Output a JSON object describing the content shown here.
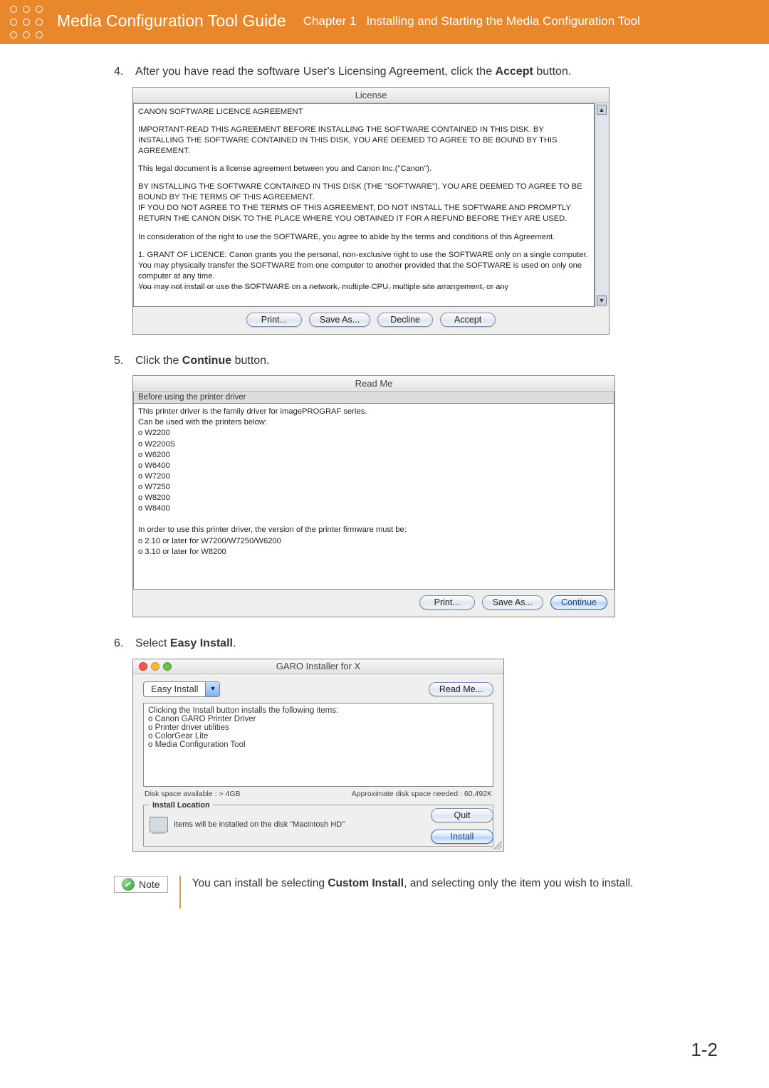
{
  "header": {
    "guide_title": "Media Configuration Tool Guide",
    "chapter_label": "Chapter 1",
    "chapter_title": "Installing and Starting the Media Configuration Tool"
  },
  "steps": {
    "s4": {
      "num": "4.",
      "text_before": "After you have read the software User's Licensing Agreement, click the ",
      "bold": "Accept",
      "text_after": " button."
    },
    "s5": {
      "num": "5.",
      "text_before": "Click the ",
      "bold": "Continue",
      "text_after": " button."
    },
    "s6": {
      "num": "6.",
      "text_before": "Select ",
      "bold": "Easy Install",
      "text_after": "."
    }
  },
  "license_dialog": {
    "title": "License",
    "p1": "CANON SOFTWARE LICENCE AGREEMENT",
    "p2": "IMPORTANT-READ THIS AGREEMENT BEFORE INSTALLING THE SOFTWARE CONTAINED IN THIS DISK. BY INSTALLING THE SOFTWARE CONTAINED IN THIS DISK, YOU ARE DEEMED TO AGREE TO BE BOUND BY THIS AGREEMENT.",
    "p3": "This legal document is a license agreement between you and Canon Inc.(\"Canon\").",
    "p4": "BY INSTALLING THE SOFTWARE CONTAINED IN THIS DISK (THE \"SOFTWARE\"), YOU ARE DEEMED TO AGREE TO BE BOUND BY THE TERMS OF THIS AGREEMENT.",
    "p5": "IF YOU DO NOT AGREE TO THE TERMS OF THIS AGREEMENT, DO NOT INSTALL THE SOFTWARE AND PROMPTLY RETURN THE CANON DISK TO THE PLACE WHERE YOU OBTAINED IT FOR A REFUND BEFORE THEY ARE USED.",
    "p6": "In consideration of the right to use the SOFTWARE, you agree to abide by the terms and conditions of this Agreement.",
    "p7": "1. GRANT OF LICENCE: Canon grants you the personal, non-exclusive right to use the SOFTWARE only on a single computer. You may physically transfer the SOFTWARE from one computer to another provided that the SOFTWARE is used on only one computer at any time.",
    "p8": "You may not install or use the SOFTWARE on a network, multiple CPU, multiple site arrangement, or any",
    "btn_print": "Print...",
    "btn_save": "Save As...",
    "btn_decline": "Decline",
    "btn_accept": "Accept"
  },
  "readme_dialog": {
    "title": "Read Me",
    "line_intro": "Before using the printer driver",
    "body1": "This printer driver is the family driver for imagePROGRAF series.",
    "body2": "Can be used with the printers below:",
    "models": [
      "o W2200",
      "o W2200S",
      "o W6200",
      "o W6400",
      "o W7200",
      "o W7250",
      "o W8200",
      "o W8400"
    ],
    "body3": "In order to use this printer driver, the version of the printer firmware must be:",
    "fw1": "o 2.10 or later for W7200/W7250/W6200",
    "fw2": "o 3.10 or later for W8200",
    "btn_print": "Print...",
    "btn_save": "Save As...",
    "btn_continue": "Continue"
  },
  "garo": {
    "title": "GARO Installer for X",
    "combo_selected": "Easy Install",
    "btn_readme": "Read Me...",
    "list_intro": "Clicking the Install button installs the following items:",
    "items": [
      "o Canon GARO Printer Driver",
      "o Printer driver utilities",
      "o ColorGear Lite",
      "o Media Configuration Tool"
    ],
    "disk_avail": "Disk space available : > 4GB",
    "disk_needed": "Approximate disk space needed : 60,492K",
    "install_loc_label": "Install Location",
    "loc_text": "Items will be installed on the disk \"Macintosh HD\"",
    "btn_quit": "Quit",
    "btn_install": "Install"
  },
  "note": {
    "label": "Note",
    "text_before": "You can install be selecting ",
    "bold": "Custom Install",
    "text_after": ", and selecting only the item you wish to install."
  },
  "page_number": "1-2"
}
